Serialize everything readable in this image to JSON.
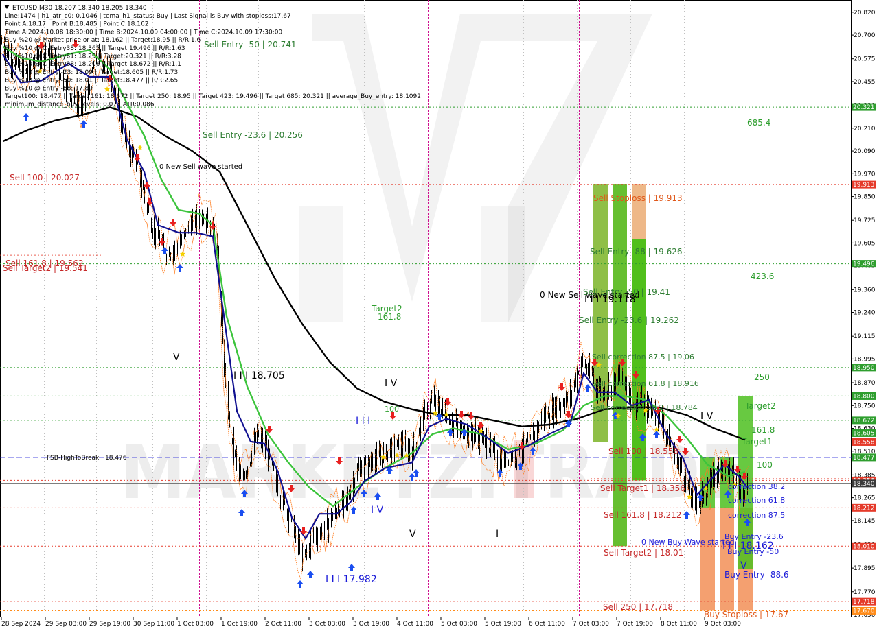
{
  "window": {
    "symbol_line": "ETCUSD,M30  18.207 18.340 18.205 18.340",
    "info_lines": [
      "Line:1474 | h1_atr_c0: 0.1046 | tema_h1_status: Buy | Last Signal is:Buy with stoploss:17.67",
      "Point A:18.17 | Point B:18.485 | Point C:18.162",
      "Time A:2024.10.08 18:30:00 | Time B:2024.10.09 04:00:00 | Time C:2024.10.09 17:30:00",
      "Buy %20 @ Market price or at: 18.162 || Target:18.95 || R/R:1.6",
      "Buy %10 @ C_Entry38: 18.365 || Target:19.496 || R/R:1.63",
      "Buy %10 @ C_Entry61: 18.29 || Target:20.321 || R/R:3.28",
      "Buy %10 @ C_Entry88: 18.206 || Target:18.672 || R/R:1.1",
      "Buy %10 @ Entry -23: 18.09 || Target:18.605 || R/R:1.73",
      "Buy %10 @ Entry -50: 18.01 || Target:18.477 || R/R:2.65",
      "Buy %10 @ Entry -88: 17.89",
      "Target100: 18.477 || Target 161: 18.672 || Target 250: 18.95 || Target 423: 19.496 || Target 685: 20.321 || average_Buy_entry: 18.1092",
      "minimum_distance_buy_levels: 0.07 | ATR:0.086"
    ]
  },
  "chart_data": {
    "type": "candlestick",
    "symbol": "ETCUSD",
    "timeframe": "M30",
    "ohlc_last": {
      "open": 18.207,
      "high": 18.34,
      "low": 18.205,
      "close": 18.34
    },
    "ylim": [
      17.65,
      20.87
    ],
    "y_ticks": [
      "20.820",
      "20.700",
      "20.575",
      "20.455",
      "20.330",
      "20.210",
      "20.090",
      "19.970",
      "19.850",
      "19.725",
      "19.605",
      "19.485",
      "19.360",
      "19.240",
      "19.115",
      "18.995",
      "18.870",
      "18.750",
      "18.630",
      "18.510",
      "18.385",
      "18.265",
      "18.145",
      "18.020",
      "17.895",
      "17.770",
      "17.650"
    ],
    "x_ticks": [
      "28 Sep 2024",
      "29 Sep 03:00",
      "29 Sep 19:00",
      "30 Sep 11:00",
      "1 Oct 03:00",
      "1 Oct 19:00",
      "2 Oct 11:00",
      "3 Oct 03:00",
      "3 Oct 19:00",
      "4 Oct 11:00",
      "5 Oct 03:00",
      "5 Oct 19:00",
      "6 Oct 11:00",
      "7 Oct 03:00",
      "7 Oct 19:00",
      "8 Oct 11:00",
      "9 Oct 03:00"
    ],
    "price_levels": [
      {
        "value": 20.321,
        "label": "20.321",
        "color": "#2e9e2e",
        "style": "dotted"
      },
      {
        "value": 19.913,
        "label": "19.913",
        "color": "#e53a2a",
        "style": "dotted"
      },
      {
        "value": 19.496,
        "label": "19.496",
        "color": "#2e9e2e",
        "style": "dotted"
      },
      {
        "value": 18.95,
        "label": "18.950",
        "color": "#2e9e2e",
        "style": "dotted"
      },
      {
        "value": 18.8,
        "label": "18.800",
        "color": "#2e9e2e",
        "style": "dotted"
      },
      {
        "value": 18.672,
        "label": "18.672",
        "color": "#2e9e2e",
        "style": "dotted"
      },
      {
        "value": 18.605,
        "label": "18.605",
        "color": "#2e9e2e",
        "style": "dotted"
      },
      {
        "value": 18.558,
        "label": "18.558",
        "color": "#e53a2a",
        "style": "dotted"
      },
      {
        "value": 18.477,
        "label": "18.477",
        "color": "#2e9e2e",
        "style": "dashed-blue"
      },
      {
        "value": 18.356,
        "label": "18.356",
        "color": "#e53a2a",
        "style": "dotted"
      },
      {
        "value": 18.34,
        "label": "18.340",
        "color": "#333333",
        "style": "solid"
      },
      {
        "value": 18.212,
        "label": "18.212",
        "color": "#e53a2a",
        "style": "dotted"
      },
      {
        "value": 18.01,
        "label": "18.010",
        "color": "#e53a2a",
        "style": "dotted"
      },
      {
        "value": 17.718,
        "label": "17.718",
        "color": "#e53a2a",
        "style": "dotted"
      },
      {
        "value": 17.67,
        "label": "17.670",
        "color": "#ff8c1a",
        "style": "dotted"
      }
    ],
    "annotations": [
      {
        "text": "Sell Entry -50 | 20.741",
        "color": "#2e7d32"
      },
      {
        "text": "Sell Entry -23.6 | 20.256",
        "color": "#2e7d32"
      },
      {
        "text": "0 New Sell wave started",
        "color": "#000000"
      },
      {
        "text": "Sell 100 | 20.027",
        "color": "#c62828"
      },
      {
        "text": "Sell 161.8 | 19.562",
        "color": "#c62828"
      },
      {
        "text": "Sell Target2 | 19.541",
        "color": "#c62828"
      },
      {
        "text": "I I I 18.705",
        "color": "#000000"
      },
      {
        "text": "FSB-HighToBreak | 18.476",
        "color": "#000000"
      },
      {
        "text": "Target2",
        "color": "#2e9e2e"
      },
      {
        "text": "161.8",
        "color": "#2e9e2e"
      },
      {
        "text": "I V",
        "color": "#000000"
      },
      {
        "text": "100",
        "color": "#2e9e2e"
      },
      {
        "text": "I I I",
        "color": "#1a1ad8"
      },
      {
        "text": "I V",
        "color": "#1a1ad8"
      },
      {
        "text": "I I I 17.982",
        "color": "#1a1ad8"
      },
      {
        "text": "V",
        "color": "#000000"
      },
      {
        "text": "I",
        "color": "#000000"
      },
      {
        "text": "V",
        "color": "#000000"
      },
      {
        "text": "Sell Stoploss | 19.913",
        "color": "#e0581a"
      },
      {
        "text": "Sell Entry -88 | 19.626",
        "color": "#2e7d32"
      },
      {
        "text": "0 New Sell wave started",
        "color": "#000000"
      },
      {
        "text": "Sell Entry -50 | 19.41",
        "color": "#2e7d32"
      },
      {
        "text": "I I I 19.118",
        "color": "#000000"
      },
      {
        "text": "Sell Entry -23.6 | 19.262",
        "color": "#2e7d32"
      },
      {
        "text": "Sell correction 87.5 | 19.06",
        "color": "#2e7d32"
      },
      {
        "text": "Sell correction 61.8 | 18.916",
        "color": "#2e7d32"
      },
      {
        "text": "Sell correction 38.2 | 18.784",
        "color": "#2e7d32"
      },
      {
        "text": "Sell 100 | 18.558",
        "color": "#c62828"
      },
      {
        "text": "Sell Target1 | 18.356",
        "color": "#c62828"
      },
      {
        "text": "Sell 161.8 | 18.212",
        "color": "#c62828"
      },
      {
        "text": "Sell Target2 | 18.01",
        "color": "#c62828"
      },
      {
        "text": "Sell 250 | 17.718",
        "color": "#c62828"
      },
      {
        "text": "685.4",
        "color": "#2e9e2e"
      },
      {
        "text": "423.6",
        "color": "#2e9e2e"
      },
      {
        "text": "250",
        "color": "#2e9e2e"
      },
      {
        "text": "Target2",
        "color": "#2e9e2e"
      },
      {
        "text": "161.8",
        "color": "#2e9e2e"
      },
      {
        "text": "Target1",
        "color": "#2e9e2e"
      },
      {
        "text": "100",
        "color": "#2e9e2e"
      },
      {
        "text": "I V",
        "color": "#000000"
      },
      {
        "text": "correction 38.2",
        "color": "#1a1ad8"
      },
      {
        "text": "correction 61.8",
        "color": "#1a1ad8"
      },
      {
        "text": "correction 87.5",
        "color": "#1a1ad8"
      },
      {
        "text": "0 New Buy Wave started",
        "color": "#1a1ad8"
      },
      {
        "text": "I I I 18.162",
        "color": "#1a1ad8"
      },
      {
        "text": "Buy Entry -23.6",
        "color": "#1a1ad8"
      },
      {
        "text": "Buy Entry -50",
        "color": "#1a1ad8"
      },
      {
        "text": "Buy Entry -88.6",
        "color": "#1a1ad8"
      },
      {
        "text": "V",
        "color": "#1a1ad8"
      },
      {
        "text": "Buy Stoploss | 17.67",
        "color": "#e0581a"
      }
    ],
    "zones": [
      {
        "name": "sell-stoploss-1",
        "from": 19.913,
        "to": 18.558,
        "color": "#c8a040"
      },
      {
        "name": "sell-stoploss-2",
        "from": 19.913,
        "to": 18.01,
        "color": "#e8a060"
      },
      {
        "name": "sell-stoploss-3",
        "from": 19.913,
        "to": 18.356,
        "color": "#e8a060"
      },
      {
        "name": "sell-entry-1",
        "from": 19.913,
        "to": 18.558,
        "color": "#6cc83c"
      },
      {
        "name": "sell-entry-2",
        "from": 19.913,
        "to": 18.01,
        "color": "#4ec020"
      },
      {
        "name": "sell-entry-3",
        "from": 19.626,
        "to": 18.356,
        "color": "#3ec010"
      },
      {
        "name": "buy-entry-1",
        "from": 18.477,
        "to": 18.212,
        "color": "#4ec020"
      },
      {
        "name": "buy-entry-2",
        "from": 18.477,
        "to": 18.212,
        "color": "#4ec020"
      },
      {
        "name": "buy-entry-3",
        "from": 18.8,
        "to": 17.89,
        "color": "#4ec020"
      },
      {
        "name": "buy-stop-1",
        "from": 18.212,
        "to": 17.67,
        "color": "#f08040"
      },
      {
        "name": "buy-stop-2",
        "from": 18.212,
        "to": 17.67,
        "color": "#f08040"
      },
      {
        "name": "buy-stop-3",
        "from": 18.212,
        "to": 17.67,
        "color": "#f08040"
      }
    ],
    "series": [
      {
        "name": "moving average (black)",
        "color": "#000000"
      },
      {
        "name": "fast moving average (green)",
        "color": "#3cc43c"
      },
      {
        "name": "tema (navy)",
        "color": "#101090"
      }
    ],
    "watermark": "MARKETZITRADE"
  }
}
